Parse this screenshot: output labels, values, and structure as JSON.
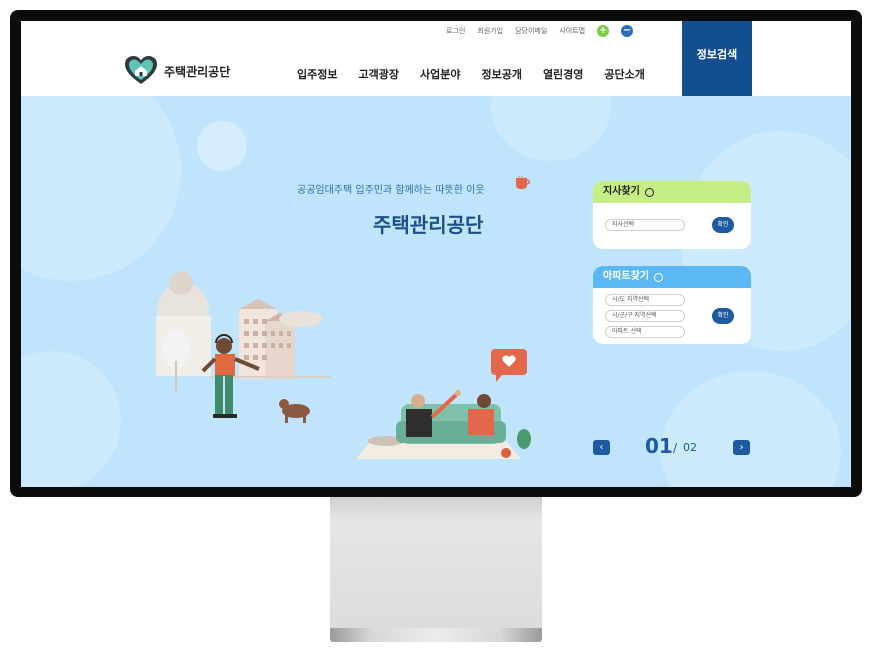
{
  "header": {
    "utility_links": [
      "로그인",
      "회원가입",
      "담당이메일",
      "사이트맵"
    ],
    "zoom_in": "+",
    "zoom_out": "−",
    "logo_text": "주택관리공단",
    "nav": [
      "입주정보",
      "고객광장",
      "사업분야",
      "정보공개",
      "열린경영",
      "공단소개"
    ],
    "search_button": "정보검색"
  },
  "hero": {
    "subtitle": "공공임대주택 입주민과 함께하는 따뜻한 이웃",
    "title": "주택관리공단"
  },
  "branch_card": {
    "title": "지사찾기",
    "select_placeholder": "지사선택",
    "confirm": "확인"
  },
  "apartment_card": {
    "title": "아파트찾기",
    "selects": [
      "시/도 지역선택",
      "시/군/구 지역선택",
      "아파트 선택"
    ],
    "confirm": "확인"
  },
  "pager": {
    "current": "01",
    "separator": "/",
    "total": "02",
    "prev": "‹",
    "next": "›"
  },
  "colors": {
    "brand_blue": "#134f8f",
    "hero_bg": "#bfe4fb",
    "card_green": "#c5ec85",
    "card_blue": "#5bb8f5"
  }
}
